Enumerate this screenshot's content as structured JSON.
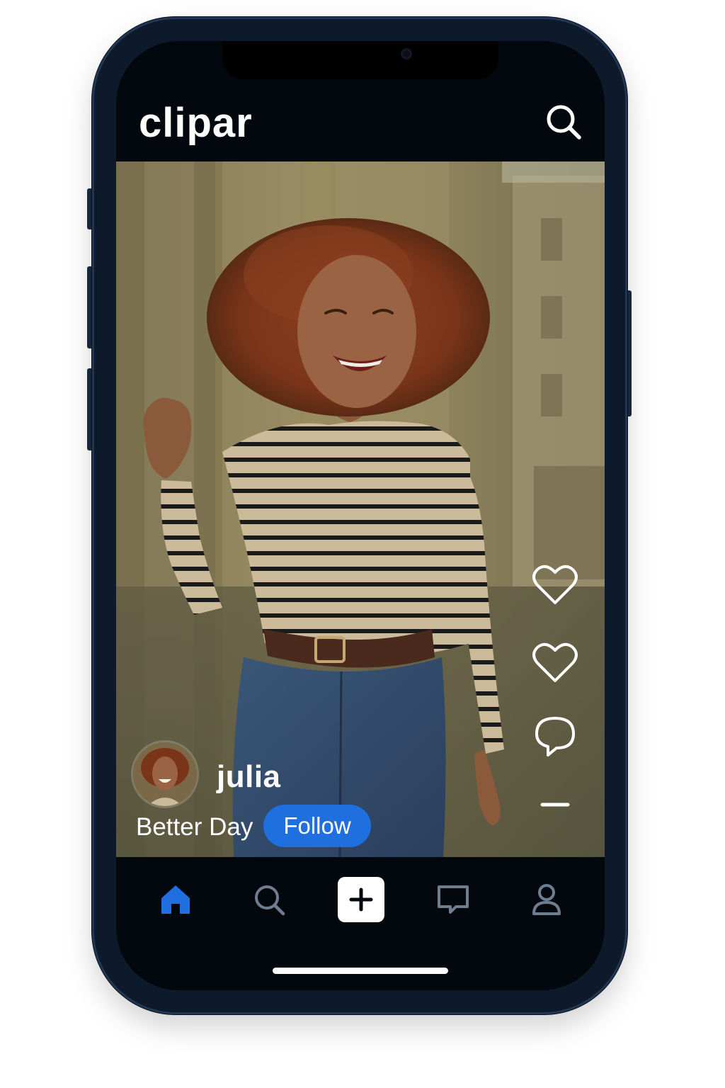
{
  "app": {
    "brand": "clipar"
  },
  "post": {
    "username": "julia",
    "song_title": "Better Day",
    "follow_label": "Follow"
  },
  "actions": [
    {
      "icon": "heart-icon"
    },
    {
      "icon": "heart-icon"
    },
    {
      "icon": "comment-icon"
    },
    {
      "icon": "more-icon"
    }
  ],
  "bottom_nav": [
    {
      "icon": "home-icon",
      "active": true
    },
    {
      "icon": "search-icon",
      "active": false
    },
    {
      "icon": "plus-icon",
      "active": false
    },
    {
      "icon": "chat-icon",
      "active": false
    },
    {
      "icon": "profile-icon",
      "active": false
    }
  ],
  "colors": {
    "background": "#03080f",
    "accent": "#1f6fe0",
    "nav_inactive": "#6f7d91"
  }
}
